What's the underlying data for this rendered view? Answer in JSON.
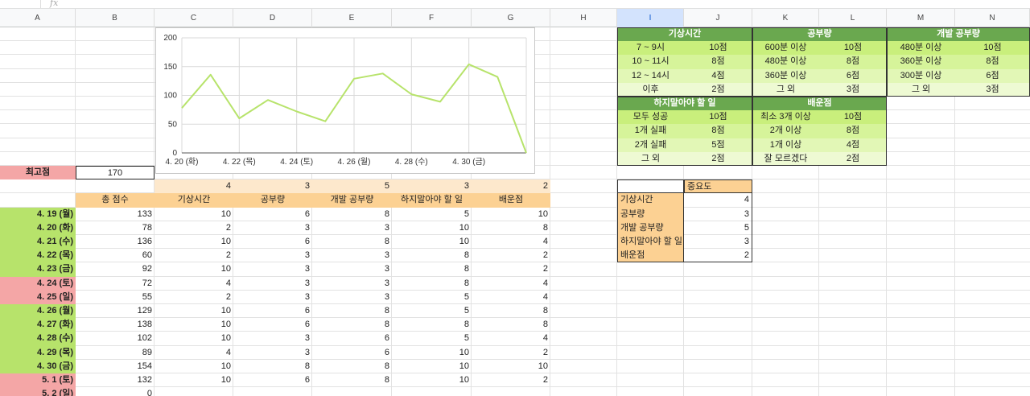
{
  "formula_bar": {
    "fx": "fx"
  },
  "columns": [
    "A",
    "B",
    "C",
    "D",
    "E",
    "F",
    "G",
    "H",
    "I",
    "J",
    "K",
    "L",
    "M",
    "N"
  ],
  "max_score": {
    "label": "최고점",
    "value": "170"
  },
  "weights": [
    "4",
    "3",
    "5",
    "3",
    "2"
  ],
  "table_headers": [
    "총 점수",
    "기상시간",
    "공부량",
    "개발 공부량",
    "하지말아야 할 일",
    "배운점"
  ],
  "rows": [
    {
      "date": "4. 19 (월)",
      "color": "green",
      "cells": [
        "133",
        "10",
        "6",
        "8",
        "5",
        "10"
      ]
    },
    {
      "date": "4. 20 (화)",
      "color": "green",
      "cells": [
        "78",
        "2",
        "3",
        "3",
        "10",
        "8"
      ]
    },
    {
      "date": "4. 21 (수)",
      "color": "green",
      "cells": [
        "136",
        "10",
        "6",
        "8",
        "10",
        "4"
      ]
    },
    {
      "date": "4. 22 (목)",
      "color": "green",
      "cells": [
        "60",
        "2",
        "3",
        "3",
        "8",
        "2"
      ]
    },
    {
      "date": "4. 23 (금)",
      "color": "green",
      "cells": [
        "92",
        "10",
        "3",
        "3",
        "8",
        "2"
      ]
    },
    {
      "date": "4. 24 (토)",
      "color": "pink",
      "cells": [
        "72",
        "4",
        "3",
        "3",
        "8",
        "4"
      ]
    },
    {
      "date": "4. 25 (일)",
      "color": "pink",
      "cells": [
        "55",
        "2",
        "3",
        "3",
        "5",
        "4"
      ]
    },
    {
      "date": "4. 26 (월)",
      "color": "green",
      "cells": [
        "129",
        "10",
        "6",
        "8",
        "5",
        "8"
      ]
    },
    {
      "date": "4. 27 (화)",
      "color": "green",
      "cells": [
        "138",
        "10",
        "6",
        "8",
        "8",
        "8"
      ]
    },
    {
      "date": "4. 28 (수)",
      "color": "green",
      "cells": [
        "102",
        "10",
        "3",
        "6",
        "5",
        "4"
      ]
    },
    {
      "date": "4. 29 (목)",
      "color": "green",
      "cells": [
        "89",
        "4",
        "3",
        "6",
        "10",
        "2"
      ]
    },
    {
      "date": "4. 30 (금)",
      "color": "green",
      "cells": [
        "154",
        "10",
        "8",
        "8",
        "10",
        "10"
      ]
    },
    {
      "date": "5. 1 (토)",
      "color": "pink",
      "cells": [
        "132",
        "10",
        "6",
        "8",
        "10",
        "2"
      ]
    },
    {
      "date": "5. 2 (일)",
      "color": "pink",
      "cells": [
        "0",
        "",
        "",
        "",
        "",
        ""
      ]
    }
  ],
  "scoring": {
    "wake": {
      "title": "기상시간",
      "rows": [
        [
          "7 ~ 9시",
          "10점"
        ],
        [
          "10 ~ 11시",
          "8점"
        ],
        [
          "12 ~ 14시",
          "4점"
        ],
        [
          "이후",
          "2점"
        ]
      ]
    },
    "study": {
      "title": "공부량",
      "rows": [
        [
          "600분 이상",
          "10점"
        ],
        [
          "480분 이상",
          "8점"
        ],
        [
          "360분 이상",
          "6점"
        ],
        [
          "그 외",
          "3점"
        ]
      ]
    },
    "dev": {
      "title": "개발 공부량",
      "rows": [
        [
          "480분 이상",
          "10점"
        ],
        [
          "360분 이상",
          "8점"
        ],
        [
          "300분 이상",
          "6점"
        ],
        [
          "그 외",
          "3점"
        ]
      ]
    },
    "avoid": {
      "title": "하지말아야 할 일",
      "rows": [
        [
          "모두 성공",
          "10점"
        ],
        [
          "1개 실패",
          "8점"
        ],
        [
          "2개 실패",
          "5점"
        ],
        [
          "그 외",
          "2점"
        ]
      ]
    },
    "learned": {
      "title": "배운점",
      "rows": [
        [
          "최소 3개 이상",
          "10점"
        ],
        [
          "2개 이상",
          "8점"
        ],
        [
          "1개 이상",
          "4점"
        ],
        [
          "잘 모르겠다",
          "2점"
        ]
      ]
    }
  },
  "importance": {
    "header": "중요도",
    "rows": [
      [
        "기상시간",
        "4"
      ],
      [
        "공부량",
        "3"
      ],
      [
        "개발 공부량",
        "5"
      ],
      [
        "하지말아야 할 일",
        "3"
      ],
      [
        "배운점",
        "2"
      ]
    ]
  },
  "colors": {
    "green": "#b7e36b",
    "pink": "#f4a6a6",
    "orange": "#fcd193",
    "table_head": "#6aa84f",
    "line": "#b7e36b"
  },
  "chart_data": {
    "type": "line",
    "x": [
      "4. 20 (화)",
      "4. 21 (수)",
      "4. 22 (목)",
      "4. 23 (금)",
      "4. 24 (토)",
      "4. 25 (일)",
      "4. 26 (월)",
      "4. 27 (화)",
      "4. 28 (수)",
      "4. 29 (목)",
      "4. 30 (금)",
      "5. 1 (토)",
      "5. 2 (일)"
    ],
    "tick_labels": [
      "4. 20 (화)",
      "4. 22 (목)",
      "4. 24 (토)",
      "4. 26 (월)",
      "4. 28 (수)",
      "4. 30 (금)"
    ],
    "series": [
      {
        "values": [
          78,
          136,
          60,
          92,
          72,
          55,
          129,
          138,
          102,
          89,
          154,
          132,
          0
        ]
      }
    ],
    "ylim": [
      0,
      200
    ],
    "yticks": [
      "0",
      "50",
      "100",
      "150",
      "200"
    ],
    "grid": true,
    "legend": "none"
  }
}
